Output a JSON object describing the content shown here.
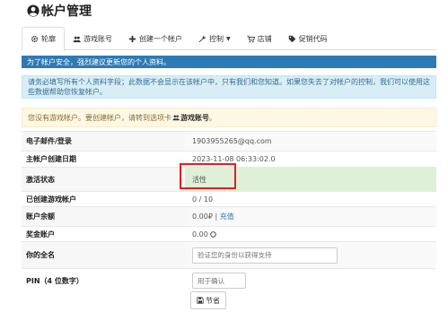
{
  "header": {
    "title": "帐户管理"
  },
  "tabs": [
    {
      "label": "轮廓",
      "icon": "gear-icon"
    },
    {
      "label": "游戏账号",
      "icon": "users-icon"
    },
    {
      "label": "创建一个帐户",
      "icon": "plus-icon"
    },
    {
      "label": "控制",
      "icon": "wrench-icon"
    },
    {
      "label": "店铺",
      "icon": "cart-icon"
    },
    {
      "label": "促销代码",
      "icon": "tag-icon"
    }
  ],
  "alerts": {
    "primary": "为了帐户安全，强烈建议更新您的个人资料。",
    "info": "请务必填写所有个人资料字段；此数据不会显示在该帐户中，只有我们和您知道。如果您失去了对帐户的控制，我们可以使用这些数据帮助您恢复帐户。",
    "warning_prefix": "您没有游戏帐户。要创建帐户，请转到选项卡",
    "warning_link": "游戏账号",
    "warning_suffix": "。"
  },
  "profile": {
    "email_label": "电子邮件/登录",
    "email_value": "1903955265@qq.com",
    "created_label": "主帐户创建日期",
    "created_value": "2023-11-08 06:33:02.0",
    "status_label": "激活状态",
    "status_value": "活性",
    "game_accounts_label": "已创建游戏帐户",
    "game_accounts_value": "0 / 10",
    "balance_label": "账户余额",
    "balance_value": "0.00₽",
    "balance_separator": " | ",
    "recharge_label": "充值",
    "bonus_label": "奖金账户",
    "bonus_value": "0.00",
    "fullname_label": "你的全名",
    "fullname_placeholder": "验证您的身份以获得支持",
    "pin_label": "PIN（4 位数字）",
    "pin_placeholder": "用于确认",
    "save_label": "节省"
  }
}
